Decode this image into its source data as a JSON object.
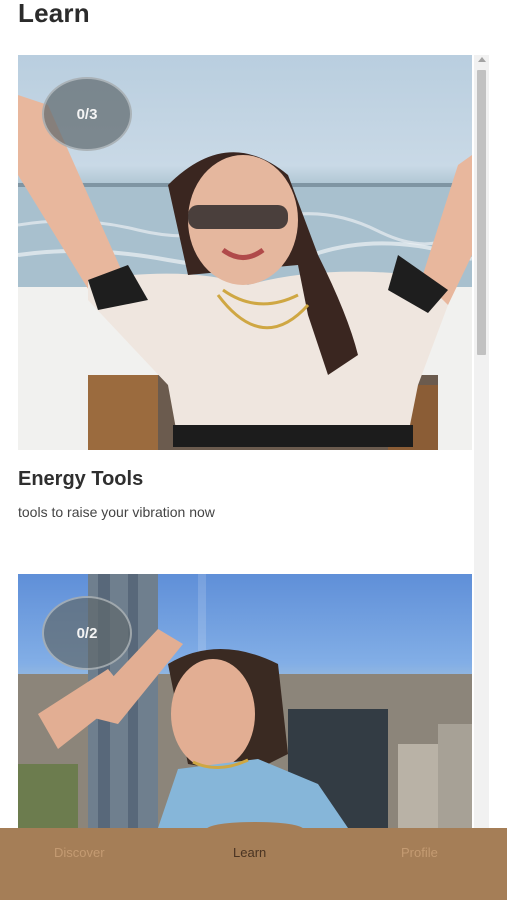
{
  "page": {
    "title": "Learn"
  },
  "cards": [
    {
      "progress": "0/3",
      "title": "Energy Tools",
      "description": "tools to raise your vibration now"
    },
    {
      "progress": "0/2",
      "title": "",
      "description": ""
    }
  ],
  "nav": {
    "items": [
      {
        "label": "Discover",
        "active": false
      },
      {
        "label": "Learn",
        "active": true
      },
      {
        "label": "Profile",
        "active": false
      }
    ]
  },
  "colors": {
    "nav_background": "#a57e57",
    "nav_active_text": "#4a3422",
    "nav_inactive_text": "#c49b72"
  }
}
